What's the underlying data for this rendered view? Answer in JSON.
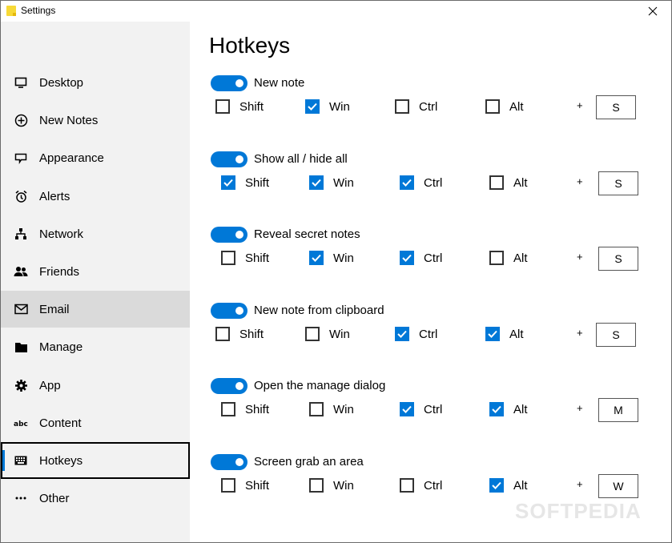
{
  "window": {
    "title": "Settings",
    "close_icon": "close-icon"
  },
  "sidebar": {
    "items": [
      {
        "label": "Desktop",
        "icon": "monitor-icon"
      },
      {
        "label": "New Notes",
        "icon": "plus-circle-icon"
      },
      {
        "label": "Appearance",
        "icon": "appearance-icon"
      },
      {
        "label": "Alerts",
        "icon": "alarm-clock-icon"
      },
      {
        "label": "Network",
        "icon": "network-icon"
      },
      {
        "label": "Friends",
        "icon": "people-icon"
      },
      {
        "label": "Email",
        "icon": "mail-icon"
      },
      {
        "label": "Manage",
        "icon": "folder-icon"
      },
      {
        "label": "App",
        "icon": "gear-icon"
      },
      {
        "label": "Content",
        "icon": "text-abc-icon"
      },
      {
        "label": "Hotkeys",
        "icon": "keyboard-icon"
      },
      {
        "label": "Other",
        "icon": "more-icon"
      }
    ],
    "hovered": "Email",
    "selected": "Hotkeys"
  },
  "main": {
    "heading": "Hotkeys",
    "modifier_labels": {
      "shift": "Shift",
      "win": "Win",
      "ctrl": "Ctrl",
      "alt": "Alt"
    },
    "plus": "+",
    "hotkeys": [
      {
        "label": "New note",
        "enabled": true,
        "shift": false,
        "win": true,
        "ctrl": false,
        "alt": false,
        "key": "S"
      },
      {
        "label": "Show all / hide all",
        "enabled": true,
        "shift": true,
        "win": true,
        "ctrl": true,
        "alt": false,
        "key": "S"
      },
      {
        "label": "Reveal secret notes",
        "enabled": true,
        "shift": false,
        "win": true,
        "ctrl": true,
        "alt": false,
        "key": "S"
      },
      {
        "label": "New note from clipboard",
        "enabled": true,
        "shift": false,
        "win": false,
        "ctrl": true,
        "alt": true,
        "key": "S"
      },
      {
        "label": "Open the manage dialog",
        "enabled": true,
        "shift": false,
        "win": false,
        "ctrl": true,
        "alt": true,
        "key": "M"
      },
      {
        "label": "Screen grab an area",
        "enabled": true,
        "shift": false,
        "win": false,
        "ctrl": false,
        "alt": true,
        "key": "W"
      }
    ]
  },
  "accent_color": "#0078d7",
  "watermark": "SOFTPEDIA"
}
